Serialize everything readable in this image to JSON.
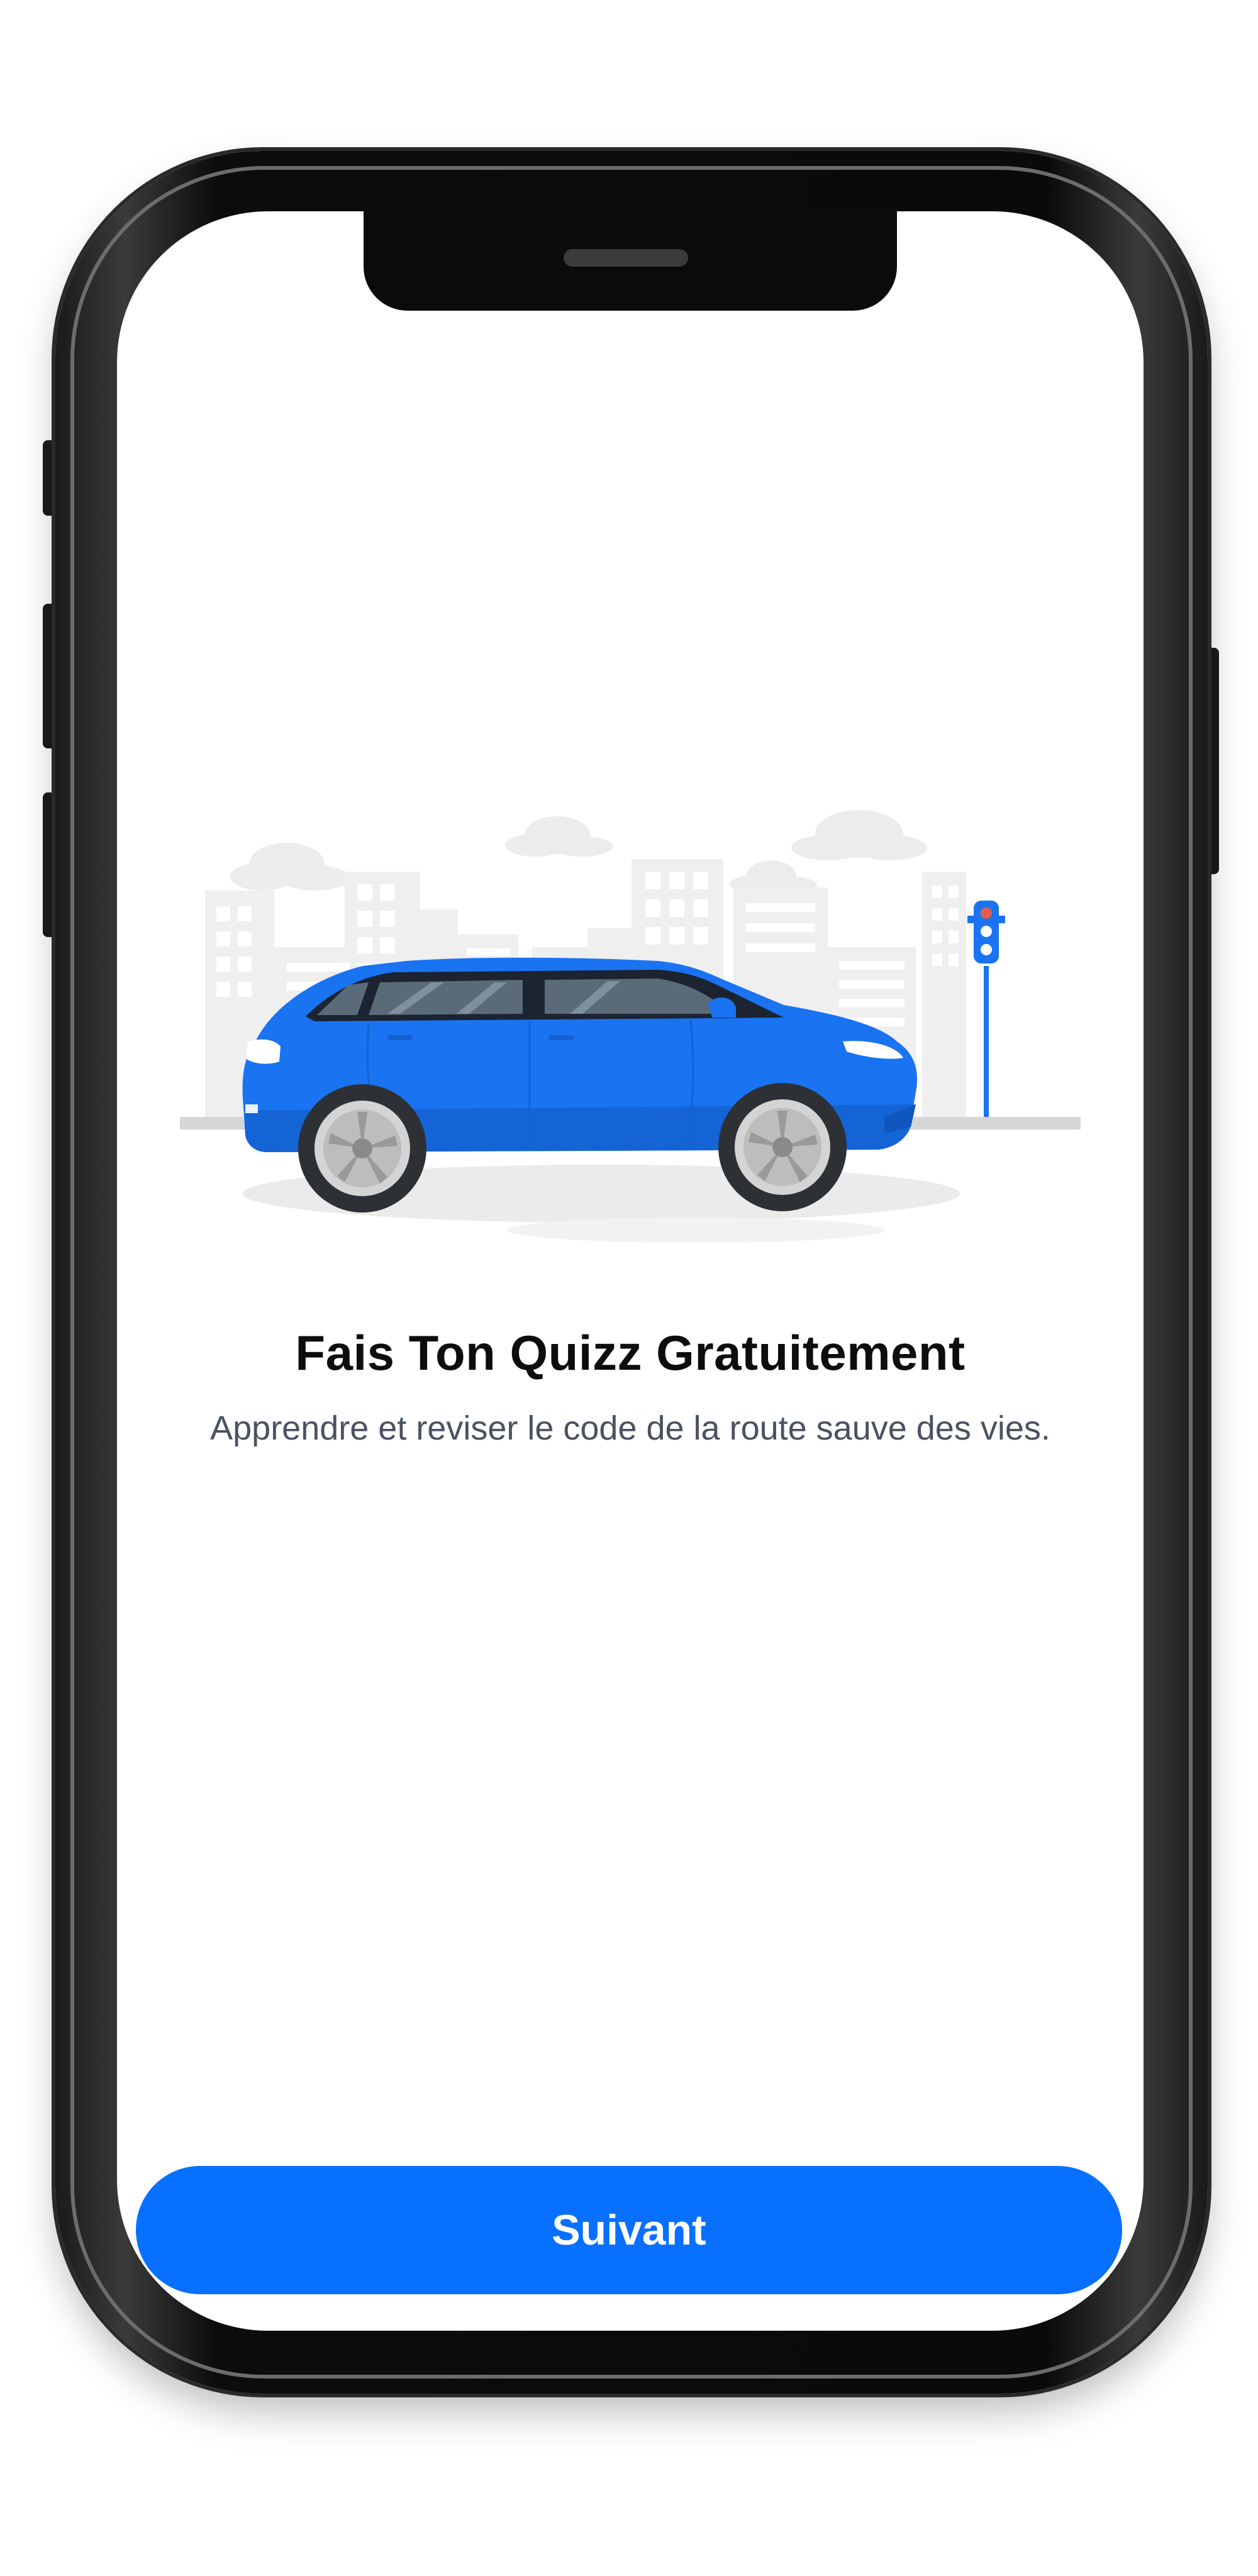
{
  "onboarding": {
    "title": "Fais Ton Quizz Gratuitement",
    "subtitle": "Apprendre et reviser le code de la route sauve des vies."
  },
  "actions": {
    "next_label": "Suivant"
  },
  "colors": {
    "primary": "#0870fe",
    "car_body": "#1a73f0",
    "buildings": "#ececec",
    "title_text": "#0d0d0d",
    "subtitle_text": "#4a5260"
  },
  "illustration": {
    "icons": [
      "car-icon",
      "city-skyline-icon",
      "traffic-light-icon",
      "cloud-icon"
    ]
  }
}
